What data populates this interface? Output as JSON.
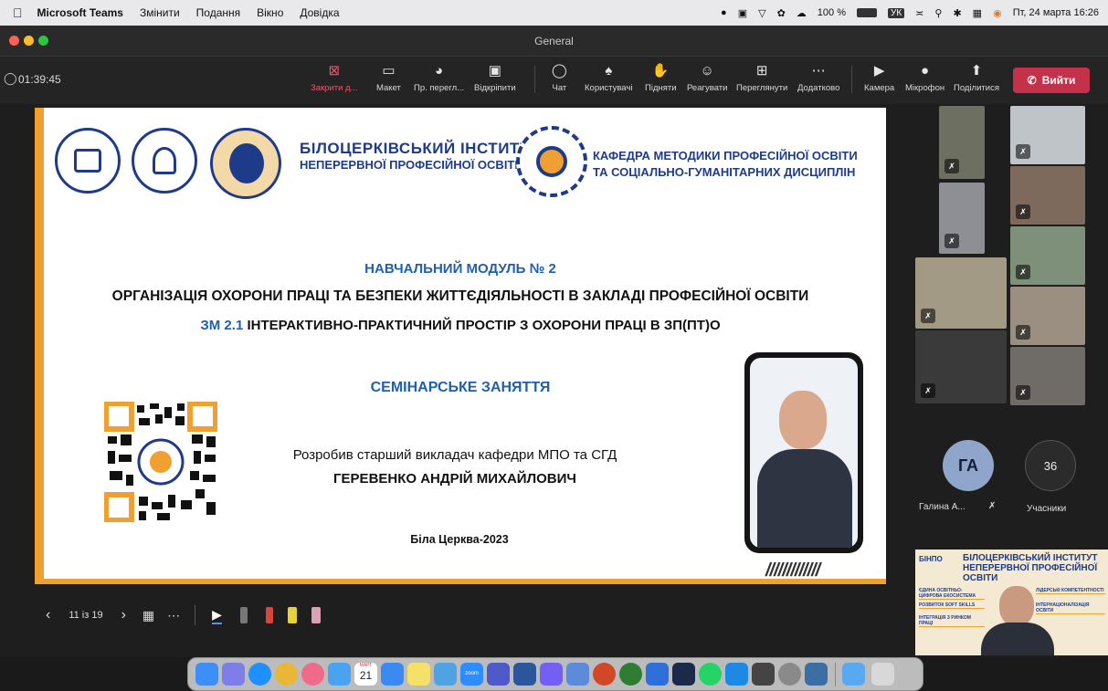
{
  "menubar": {
    "app": "Microsoft Teams",
    "items": [
      "Змінити",
      "Подання",
      "Вікно",
      "Довідка"
    ],
    "battery": "100 %",
    "keyboard": "УК",
    "datetime": "Пт, 24 марта  16:26"
  },
  "window": {
    "title": "General"
  },
  "meeting": {
    "timer": "01:39:45",
    "leave_label": "Вийти"
  },
  "toolbar": [
    {
      "label": "Закрити д...",
      "icon": "close-share-icon"
    },
    {
      "label": "Макет",
      "icon": "layout-icon"
    },
    {
      "label": "Пр. перегл...",
      "icon": "eye-icon"
    },
    {
      "label": "Відкріпити",
      "icon": "pop-out-icon"
    },
    {
      "label": "Чат",
      "icon": "chat-icon"
    },
    {
      "label": "Користувачі",
      "icon": "people-icon"
    },
    {
      "label": "Підняти",
      "icon": "raise-hand-icon"
    },
    {
      "label": "Реагувати",
      "icon": "smile-icon"
    },
    {
      "label": "Переглянути",
      "icon": "view-icon"
    },
    {
      "label": "Додатково",
      "icon": "more-icon"
    },
    {
      "label": "Камера",
      "icon": "camera-icon"
    },
    {
      "label": "Мікрофон",
      "icon": "mic-icon"
    },
    {
      "label": "Поділитися",
      "icon": "share-icon"
    }
  ],
  "slide": {
    "institute": [
      "БІЛОЦЕРКІВСЬКИЙ ІНСТИТУТ",
      "НЕПЕРЕРВНОЇ ПРОФЕСІЙНОЇ ОСВІТИ"
    ],
    "department": [
      "КАФЕДРА МЕТОДИКИ ПРОФЕСІЙНОЇ ОСВІТИ",
      "ТА СОЦІАЛЬНО-ГУМАНІТАРНИХ ДИСЦИПЛІН"
    ],
    "module": "НАВЧАЛЬНИЙ МОДУЛЬ № 2",
    "topic": "ОРГАНІЗАЦІЯ ОХОРОНИ ПРАЦІ ТА БЕЗПЕКИ ЖИТТЄДІЯЛЬНОСТІ В ЗАКЛАДІ ПРОФЕСІЙНОЇ ОСВІТИ",
    "submodule_code": "ЗМ 2.1",
    "submodule": "ІНТЕРАКТИВНО-ПРАКТИЧНИЙ ПРОСТІР З ОХОРОНИ ПРАЦІ В ЗП(ПТ)О",
    "lesson_type": "СЕМІНАРСЬКЕ ЗАНЯТТЯ",
    "author_line": "Розробив старший викладач кафедри МПО та СГД",
    "author_name": "ГЕРЕВЕНКО АНДРІЙ МИХАЙЛОВИЧ",
    "place_year": "Біла Церква-2023",
    "stripes": "/////////////"
  },
  "slide_controls": {
    "page": "11 із 19"
  },
  "participants": {
    "initials": "ГА",
    "name": "Галина А...",
    "count": "36",
    "count_label": "Учасники"
  },
  "preview": {
    "institute": [
      "БІЛОЦЕРКІВСЬКИЙ ІНСТИТУТ",
      "НЕПЕРЕРВНОЇ ПРОФЕСІЙНОЇ ОСВІТИ"
    ],
    "abbr": "БІНПО",
    "items": [
      "ЄДИНА ОСВІТНЬО-ЦИФРОВА ЕКОСИСТЕМА",
      "РОЗВИТОК SOFT SKILLS",
      "ІНТЕГРАЦІЯ З РИНКОМ ПРАЦІ",
      "ЛІДЕРСЬКІ КОМПЕТЕНТНОСТІ",
      "ІНТЕРНАЦІОНАЛІЗАЦІЯ ОСВІТИ"
    ]
  },
  "dock": {
    "calendar_month": "МАРТ",
    "calendar_day": "21",
    "zoom": "zoom"
  }
}
